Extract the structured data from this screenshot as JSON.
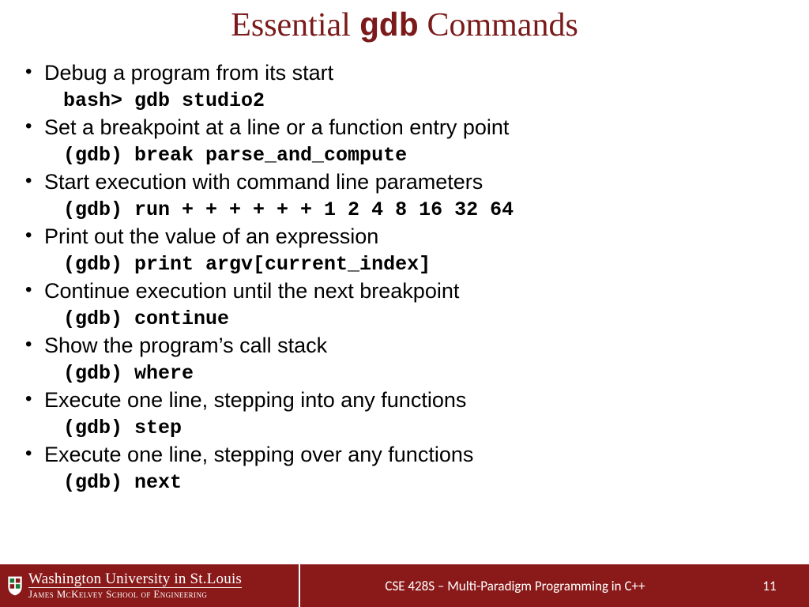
{
  "title": {
    "prefix": "Essential ",
    "mono": "gdb",
    "suffix": " Commands"
  },
  "items": [
    {
      "desc": "Debug a program from its start",
      "cmd": "bash> gdb studio2"
    },
    {
      "desc": "Set a breakpoint at a line or a function entry point",
      "cmd": "(gdb) break parse_and_compute"
    },
    {
      "desc": "Start execution with command line parameters",
      "cmd": "(gdb) run + + + + + + 1 2 4 8 16 32 64"
    },
    {
      "desc": "Print out the value of an expression",
      "cmd": "(gdb) print argv[current_index]"
    },
    {
      "desc": "Continue execution until the next breakpoint",
      "cmd": "(gdb) continue"
    },
    {
      "desc": "Show the program’s call stack",
      "cmd": "(gdb) where"
    },
    {
      "desc": "Execute one line, stepping into any functions",
      "cmd": "(gdb) step"
    },
    {
      "desc": "Execute one line, stepping over any functions",
      "cmd": "(gdb) next"
    }
  ],
  "footer": {
    "univ_top": "Washington University in St.Louis",
    "univ_bot": "James McKelvey School of Engineering",
    "course": "CSE 428S – Multi-Paradigm Programming  in C++",
    "page": "11"
  }
}
